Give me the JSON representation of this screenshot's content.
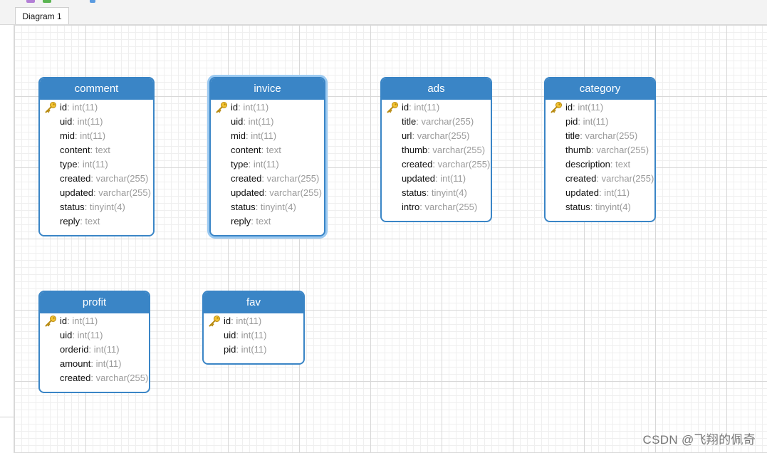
{
  "tabs": [
    {
      "label": "Diagram 1",
      "active": true
    }
  ],
  "colors": {
    "accent": "#3a85c6",
    "selection": "#9ccaf1",
    "key_icon": "#e8b21a"
  },
  "watermark": "CSDN @飞翔的佩奇",
  "entities": [
    {
      "name": "comment",
      "fields": [
        {
          "name": "id",
          "type": "int(11)",
          "pk": true
        },
        {
          "name": "uid",
          "type": "int(11)"
        },
        {
          "name": "mid",
          "type": "int(11)"
        },
        {
          "name": "content",
          "type": "text"
        },
        {
          "name": "type",
          "type": "int(11)"
        },
        {
          "name": "created",
          "type": "varchar(255)"
        },
        {
          "name": "updated",
          "type": "varchar(255)"
        },
        {
          "name": "status",
          "type": "tinyint(4)"
        },
        {
          "name": "reply",
          "type": "text"
        }
      ]
    },
    {
      "name": "invice",
      "selected": true,
      "fields": [
        {
          "name": "id",
          "type": "int(11)",
          "pk": true
        },
        {
          "name": "uid",
          "type": "int(11)"
        },
        {
          "name": "mid",
          "type": "int(11)"
        },
        {
          "name": "content",
          "type": "text"
        },
        {
          "name": "type",
          "type": "int(11)"
        },
        {
          "name": "created",
          "type": "varchar(255)"
        },
        {
          "name": "updated",
          "type": "varchar(255)"
        },
        {
          "name": "status",
          "type": "tinyint(4)"
        },
        {
          "name": "reply",
          "type": "text"
        }
      ]
    },
    {
      "name": "ads",
      "fields": [
        {
          "name": "id",
          "type": "int(11)",
          "pk": true
        },
        {
          "name": "title",
          "type": "varchar(255)"
        },
        {
          "name": "url",
          "type": "varchar(255)"
        },
        {
          "name": "thumb",
          "type": "varchar(255)"
        },
        {
          "name": "created",
          "type": "varchar(255)"
        },
        {
          "name": "updated",
          "type": "int(11)"
        },
        {
          "name": "status",
          "type": "tinyint(4)"
        },
        {
          "name": "intro",
          "type": "varchar(255)"
        }
      ]
    },
    {
      "name": "category",
      "fields": [
        {
          "name": "id",
          "type": "int(11)",
          "pk": true
        },
        {
          "name": "pid",
          "type": "int(11)"
        },
        {
          "name": "title",
          "type": "varchar(255)"
        },
        {
          "name": "thumb",
          "type": "varchar(255)"
        },
        {
          "name": "description",
          "type": "text"
        },
        {
          "name": "created",
          "type": "varchar(255)"
        },
        {
          "name": "updated",
          "type": "int(11)"
        },
        {
          "name": "status",
          "type": "tinyint(4)"
        }
      ]
    },
    {
      "name": "profit",
      "fields": [
        {
          "name": "id",
          "type": "int(11)",
          "pk": true
        },
        {
          "name": "uid",
          "type": "int(11)"
        },
        {
          "name": "orderid",
          "type": "int(11)"
        },
        {
          "name": "amount",
          "type": "int(11)"
        },
        {
          "name": "created",
          "type": "varchar(255)"
        }
      ]
    },
    {
      "name": "fav",
      "fields": [
        {
          "name": "id",
          "type": "int(11)",
          "pk": true
        },
        {
          "name": "uid",
          "type": "int(11)"
        },
        {
          "name": "pid",
          "type": "int(11)"
        }
      ]
    }
  ]
}
